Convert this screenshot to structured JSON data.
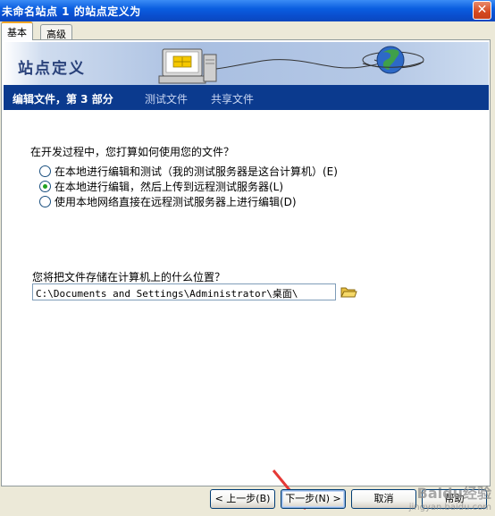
{
  "window": {
    "title": "未命名站点 1 的站点定义为"
  },
  "tabs": [
    {
      "label": "基本"
    },
    {
      "label": "高级"
    }
  ],
  "banner": {
    "title": "站点定义"
  },
  "steps": {
    "current": "编辑文件，第 3 部分",
    "step2": "测试文件",
    "step3": "共享文件"
  },
  "question1": "在开发过程中，您打算如何使用您的文件？",
  "options": [
    {
      "label": "在本地进行编辑和测试（我的测试服务器是这台计算机）(E)",
      "checked": false
    },
    {
      "label": "在本地进行编辑，然后上传到远程测试服务器(L)",
      "checked": true
    },
    {
      "label": "使用本地网络直接在远程测试服务器上进行编辑(D)",
      "checked": false
    }
  ],
  "question2": "您将把文件存储在计算机上的什么位置？",
  "path": {
    "value": "C:\\Documents and Settings\\Administrator\\桌面\\"
  },
  "buttons": {
    "back": "< 上一步(B)",
    "next": "下一步(N) >",
    "cancel": "取消",
    "help": "帮助"
  },
  "watermark": {
    "brand": "Baidu经验",
    "url": "jingyan.baidu.com"
  },
  "icons": {
    "close": "close-icon",
    "folder": "folder-icon",
    "computer": "computer-icon",
    "globe": "globe-icon",
    "arrow": "annotation-arrow"
  },
  "colors": {
    "titlebar": "#0a5ee0",
    "stepbar": "#0b3a8e",
    "radio_checked": "#21a121",
    "arrow": "#e53935"
  }
}
